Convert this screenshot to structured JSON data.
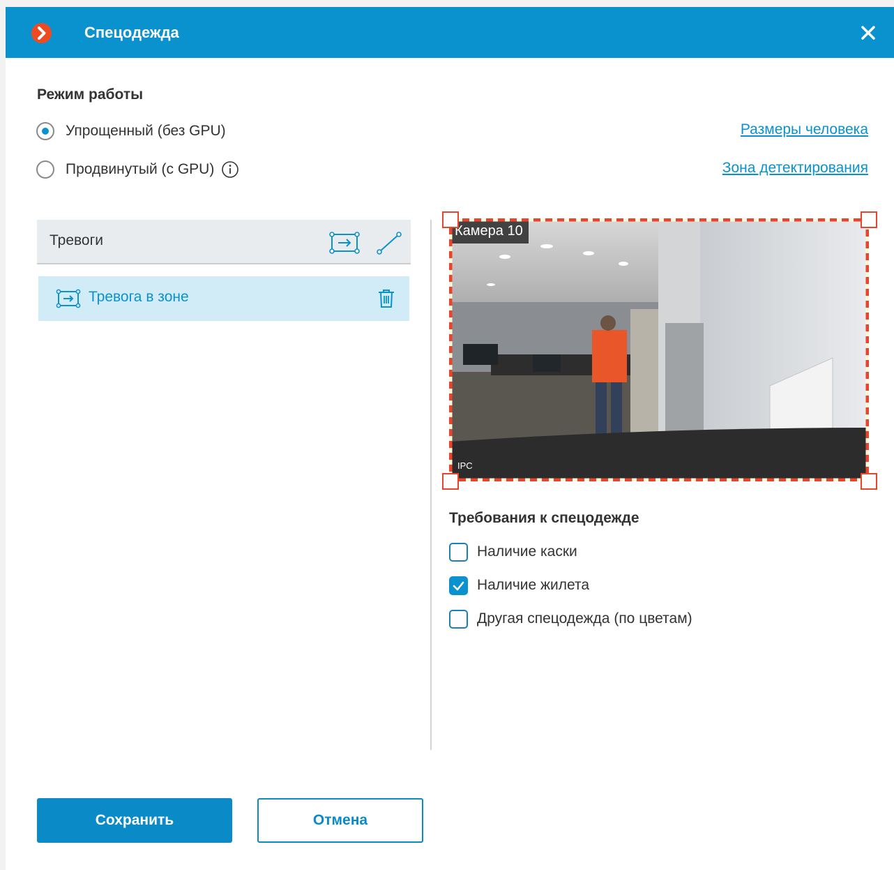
{
  "window": {
    "title": "Спецодежда",
    "icons": {
      "app": "app-logo-icon",
      "close": "close-icon"
    }
  },
  "mode": {
    "title": "Режим работы",
    "options": [
      {
        "label": "Упрощенный (без GPU)",
        "selected": true
      },
      {
        "label": "Продвинутый (с GPU)",
        "selected": false
      }
    ]
  },
  "links": {
    "person_size": "Размеры человека",
    "detection_zone": "Зона детектирования"
  },
  "alarms": {
    "title": "Тревоги",
    "items": [
      {
        "label": "Тревога в зоне",
        "icon": "zone-icon"
      }
    ]
  },
  "video": {
    "camera_label": "Камера 10",
    "ipc_label": "IPC"
  },
  "requirements": {
    "title": "Требования к спецодежде",
    "options": [
      {
        "label": "Наличие каски",
        "checked": false
      },
      {
        "label": "Наличие жилета",
        "checked": true
      },
      {
        "label": "Другая спецодежда (по цветам)",
        "checked": false
      }
    ]
  },
  "buttons": {
    "save": "Сохранить",
    "cancel": "Отмена"
  },
  "colors": {
    "accent": "#0a92cf",
    "zone": "#e8452c",
    "logo": "#ef4b23"
  }
}
